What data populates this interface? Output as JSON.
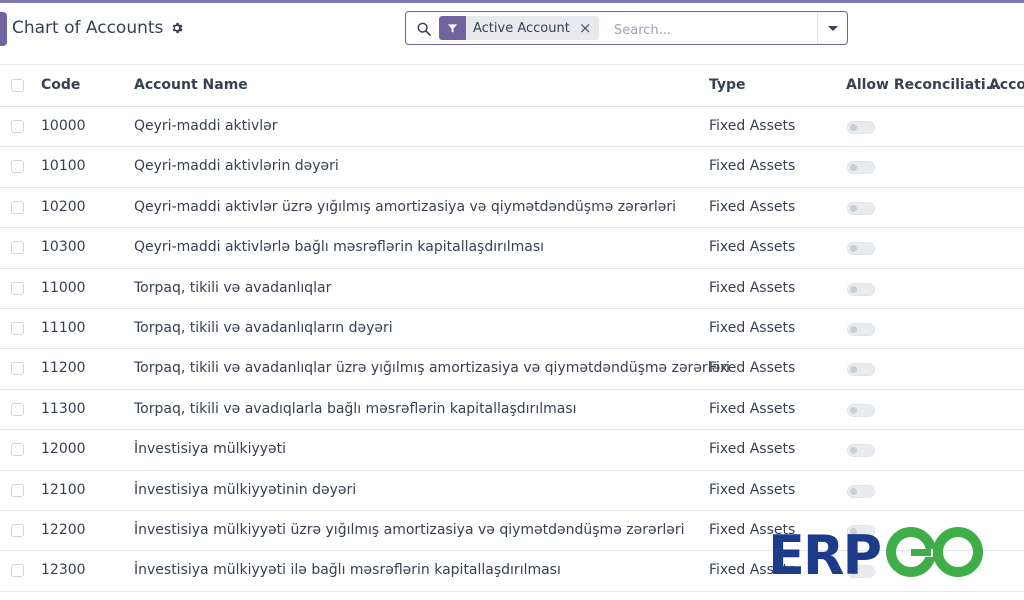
{
  "header": {
    "title": "Chart of Accounts",
    "gear_icon": "gear-icon"
  },
  "search": {
    "facet_icon": "filter-icon",
    "facet_label": "Active Account",
    "facet_remove": "×",
    "placeholder": "Search..."
  },
  "table": {
    "columns": {
      "code": "Code",
      "name": "Account Name",
      "type": "Type",
      "reconcile": "Allow Reconciliati...",
      "account": "Acco"
    },
    "rows": [
      {
        "code": "10000",
        "name": "Qeyri-maddi aktivlər",
        "type": "Fixed Assets",
        "reconcile": false
      },
      {
        "code": "10100",
        "name": "Qeyri-maddi aktivlərin dəyəri",
        "type": "Fixed Assets",
        "reconcile": false
      },
      {
        "code": "10200",
        "name": "Qeyri-maddi aktivlər üzrə yığılmış amortizasiya və qiymətdəndüşmə zərərləri",
        "type": "Fixed Assets",
        "reconcile": false
      },
      {
        "code": "10300",
        "name": "Qeyri-maddi aktivlərlə bağlı məsrəflərin kapitallaşdırılması",
        "type": "Fixed Assets",
        "reconcile": false
      },
      {
        "code": "11000",
        "name": "Torpaq, tikili və avadanlıqlar",
        "type": "Fixed Assets",
        "reconcile": false
      },
      {
        "code": "11100",
        "name": "Torpaq, tikili və avadanlıqların dəyəri",
        "type": "Fixed Assets",
        "reconcile": false
      },
      {
        "code": "11200",
        "name": "Torpaq, tikili və avadanlıqlar üzrə yığılmış amortizasiya və qiymətdəndüşmə zərərləri",
        "type": "Fixed Assets",
        "reconcile": false
      },
      {
        "code": "11300",
        "name": "Torpaq, tikili və avadıqlarla bağlı məsrəflərin kapitallaşdırılması",
        "type": "Fixed Assets",
        "reconcile": false
      },
      {
        "code": "12000",
        "name": "İnvestisiya mülkiyyəti",
        "type": "Fixed Assets",
        "reconcile": false
      },
      {
        "code": "12100",
        "name": "İnvestisiya mülkiyyətinin dəyəri",
        "type": "Fixed Assets",
        "reconcile": false
      },
      {
        "code": "12200",
        "name": "İnvestisiya mülkiyyəti üzrə yığılmış amortizasiya və qiymətdəndüşmə zərərləri",
        "type": "Fixed Assets",
        "reconcile": false
      },
      {
        "code": "12300",
        "name": "İnvestisiya mülkiyyəti ilə bağlı məsrəflərin kapitallaşdırılması",
        "type": "Fixed Assets",
        "reconcile": false
      }
    ]
  },
  "watermark": {
    "text": "ERPGO",
    "colors": {
      "erp": "#1e3a8a",
      "go": "#3fae49"
    }
  },
  "colors": {
    "accent": "#71639e",
    "border": "#dee2e6"
  }
}
